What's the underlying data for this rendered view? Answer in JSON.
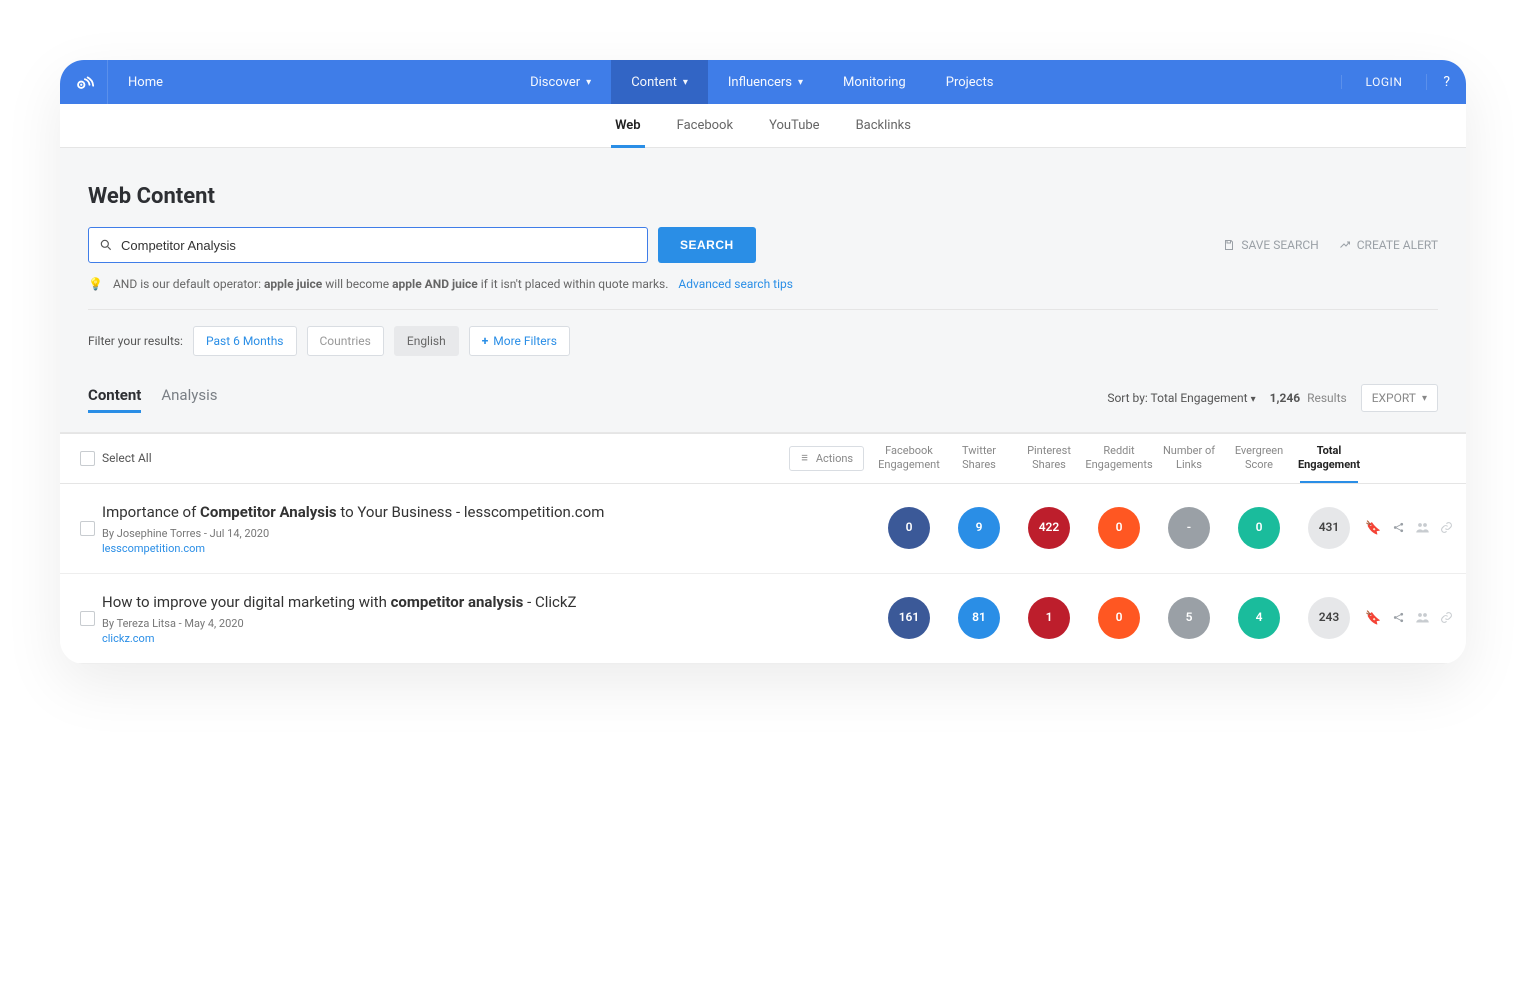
{
  "nav": {
    "home": "Home",
    "discover": "Discover",
    "content": "Content",
    "influencers": "Influencers",
    "monitoring": "Monitoring",
    "projects": "Projects",
    "login": "LOGIN",
    "help": "?"
  },
  "subtabs": {
    "web": "Web",
    "facebook": "Facebook",
    "youtube": "YouTube",
    "backlinks": "Backlinks"
  },
  "page": {
    "title": "Web Content",
    "search_value": "Competitor Analysis",
    "search_btn": "SEARCH",
    "save_search": "SAVE SEARCH",
    "create_alert": "CREATE ALERT",
    "hint_pre": "AND is our default operator: ",
    "hint_bold1": "apple juice",
    "hint_mid": " will become ",
    "hint_bold2": "apple AND juice",
    "hint_post": " if it isn't placed within quote marks.",
    "hint_link": "Advanced search tips",
    "filter_label": "Filter your results:",
    "filter_pills": {
      "past6": "Past 6 Months",
      "countries": "Countries",
      "english": "English",
      "more": "More Filters"
    }
  },
  "results": {
    "tabs": {
      "content": "Content",
      "analysis": "Analysis"
    },
    "sort_label": "Sort by: Total Engagement",
    "count": "1,246",
    "count_label": "Results",
    "export": "EXPORT",
    "select_all": "Select All",
    "actions": "Actions",
    "columns": {
      "fb": "Facebook Engagement",
      "tw": "Twitter Shares",
      "pin": "Pinterest Shares",
      "rd": "Reddit Engagements",
      "links": "Number of Links",
      "ever": "Evergreen Score",
      "total": "Total Engagement"
    },
    "rows": [
      {
        "title_pre": "Importance of ",
        "title_bold": "Competitor Analysis",
        "title_post": " to Your Business - lesscompetition.com",
        "byline": "By Josephine Torres - Jul 14, 2020",
        "domain": "lesscompetition.com",
        "fb": "0",
        "tw": "9",
        "pin": "422",
        "rd": "0",
        "links": "-",
        "ever": "0",
        "total": "431"
      },
      {
        "title_pre": "How to improve your digital marketing with ",
        "title_bold": "competitor analysis",
        "title_post": " - ClickZ",
        "byline": "By Tereza Litsa - May 4, 2020",
        "domain": "clickz.com",
        "fb": "161",
        "tw": "81",
        "pin": "1",
        "rd": "0",
        "links": "5",
        "ever": "4",
        "total": "243"
      }
    ]
  }
}
